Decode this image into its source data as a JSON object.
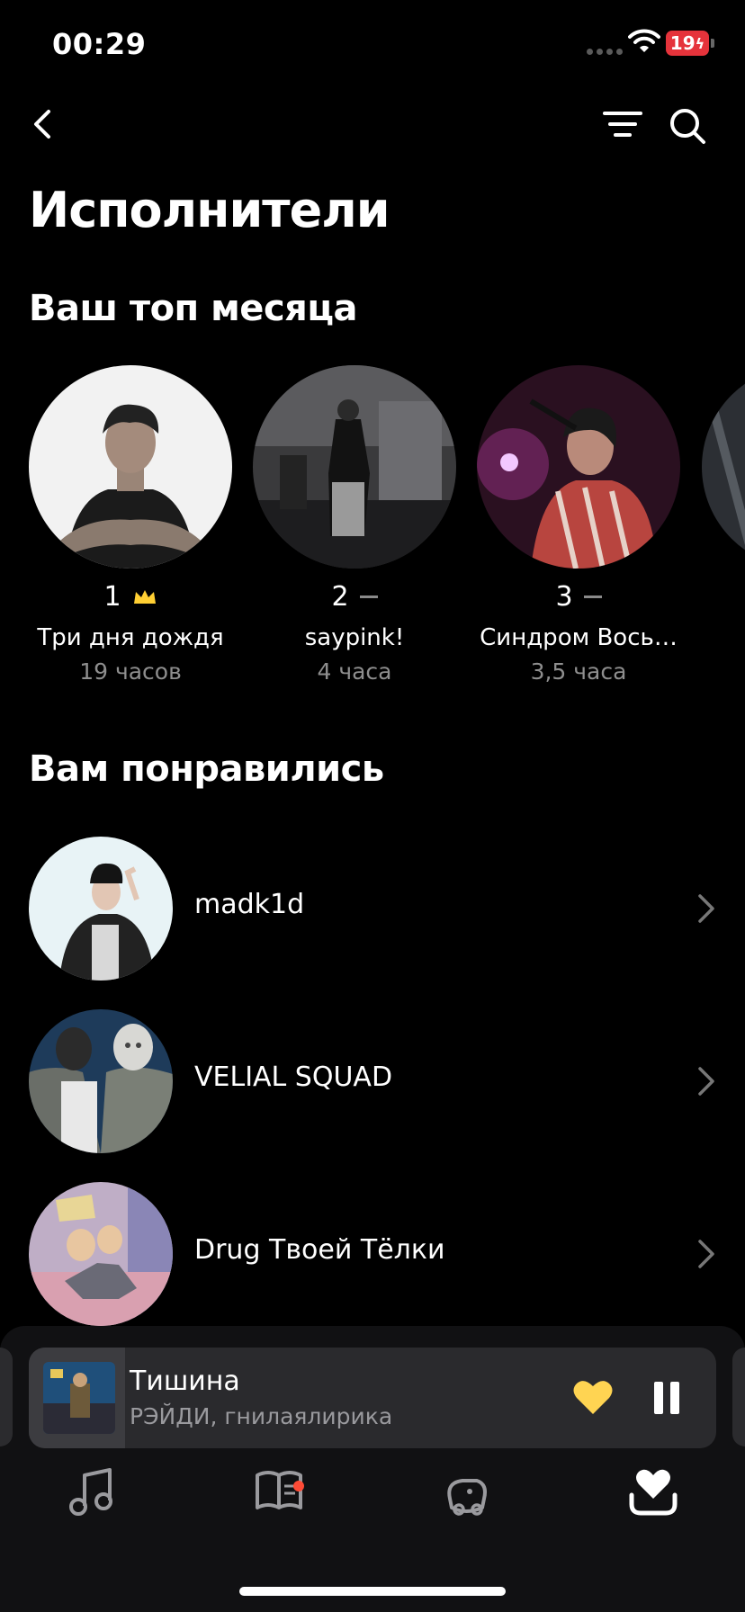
{
  "status_bar": {
    "time": "00:29",
    "battery": "19"
  },
  "page": {
    "title": "Исполнители"
  },
  "top_month": {
    "title": "Ваш топ месяца",
    "artists": [
      {
        "rank": "1",
        "name": "Три дня дождя",
        "hours": "19 часов",
        "trend": "crown"
      },
      {
        "rank": "2",
        "name": "saypink!",
        "hours": "4 часа",
        "trend": "same"
      },
      {
        "rank": "3",
        "name": "Синдром Вось…",
        "hours": "3,5 часа",
        "trend": "same"
      }
    ]
  },
  "liked": {
    "title": "Вам понравились",
    "artists": [
      {
        "name": "madk1d"
      },
      {
        "name": "VELIAL SQUAD"
      },
      {
        "name": "Drug Твоей Тёлки"
      }
    ]
  },
  "player": {
    "title": "Тишина",
    "artist": "РЭЙДИ, гнилаялирика",
    "liked": true,
    "state": "playing",
    "progress": 0.14
  },
  "tabs": [
    {
      "icon": "music-note-icon"
    },
    {
      "icon": "feed-icon",
      "badge": true
    },
    {
      "icon": "kids-icon"
    },
    {
      "icon": "collection-heart-icon",
      "active": true
    }
  ],
  "colors": {
    "accent": "#ffd452",
    "crown": "#ffcf33",
    "badge": "#ff4b36",
    "battery": "#e5333b"
  }
}
